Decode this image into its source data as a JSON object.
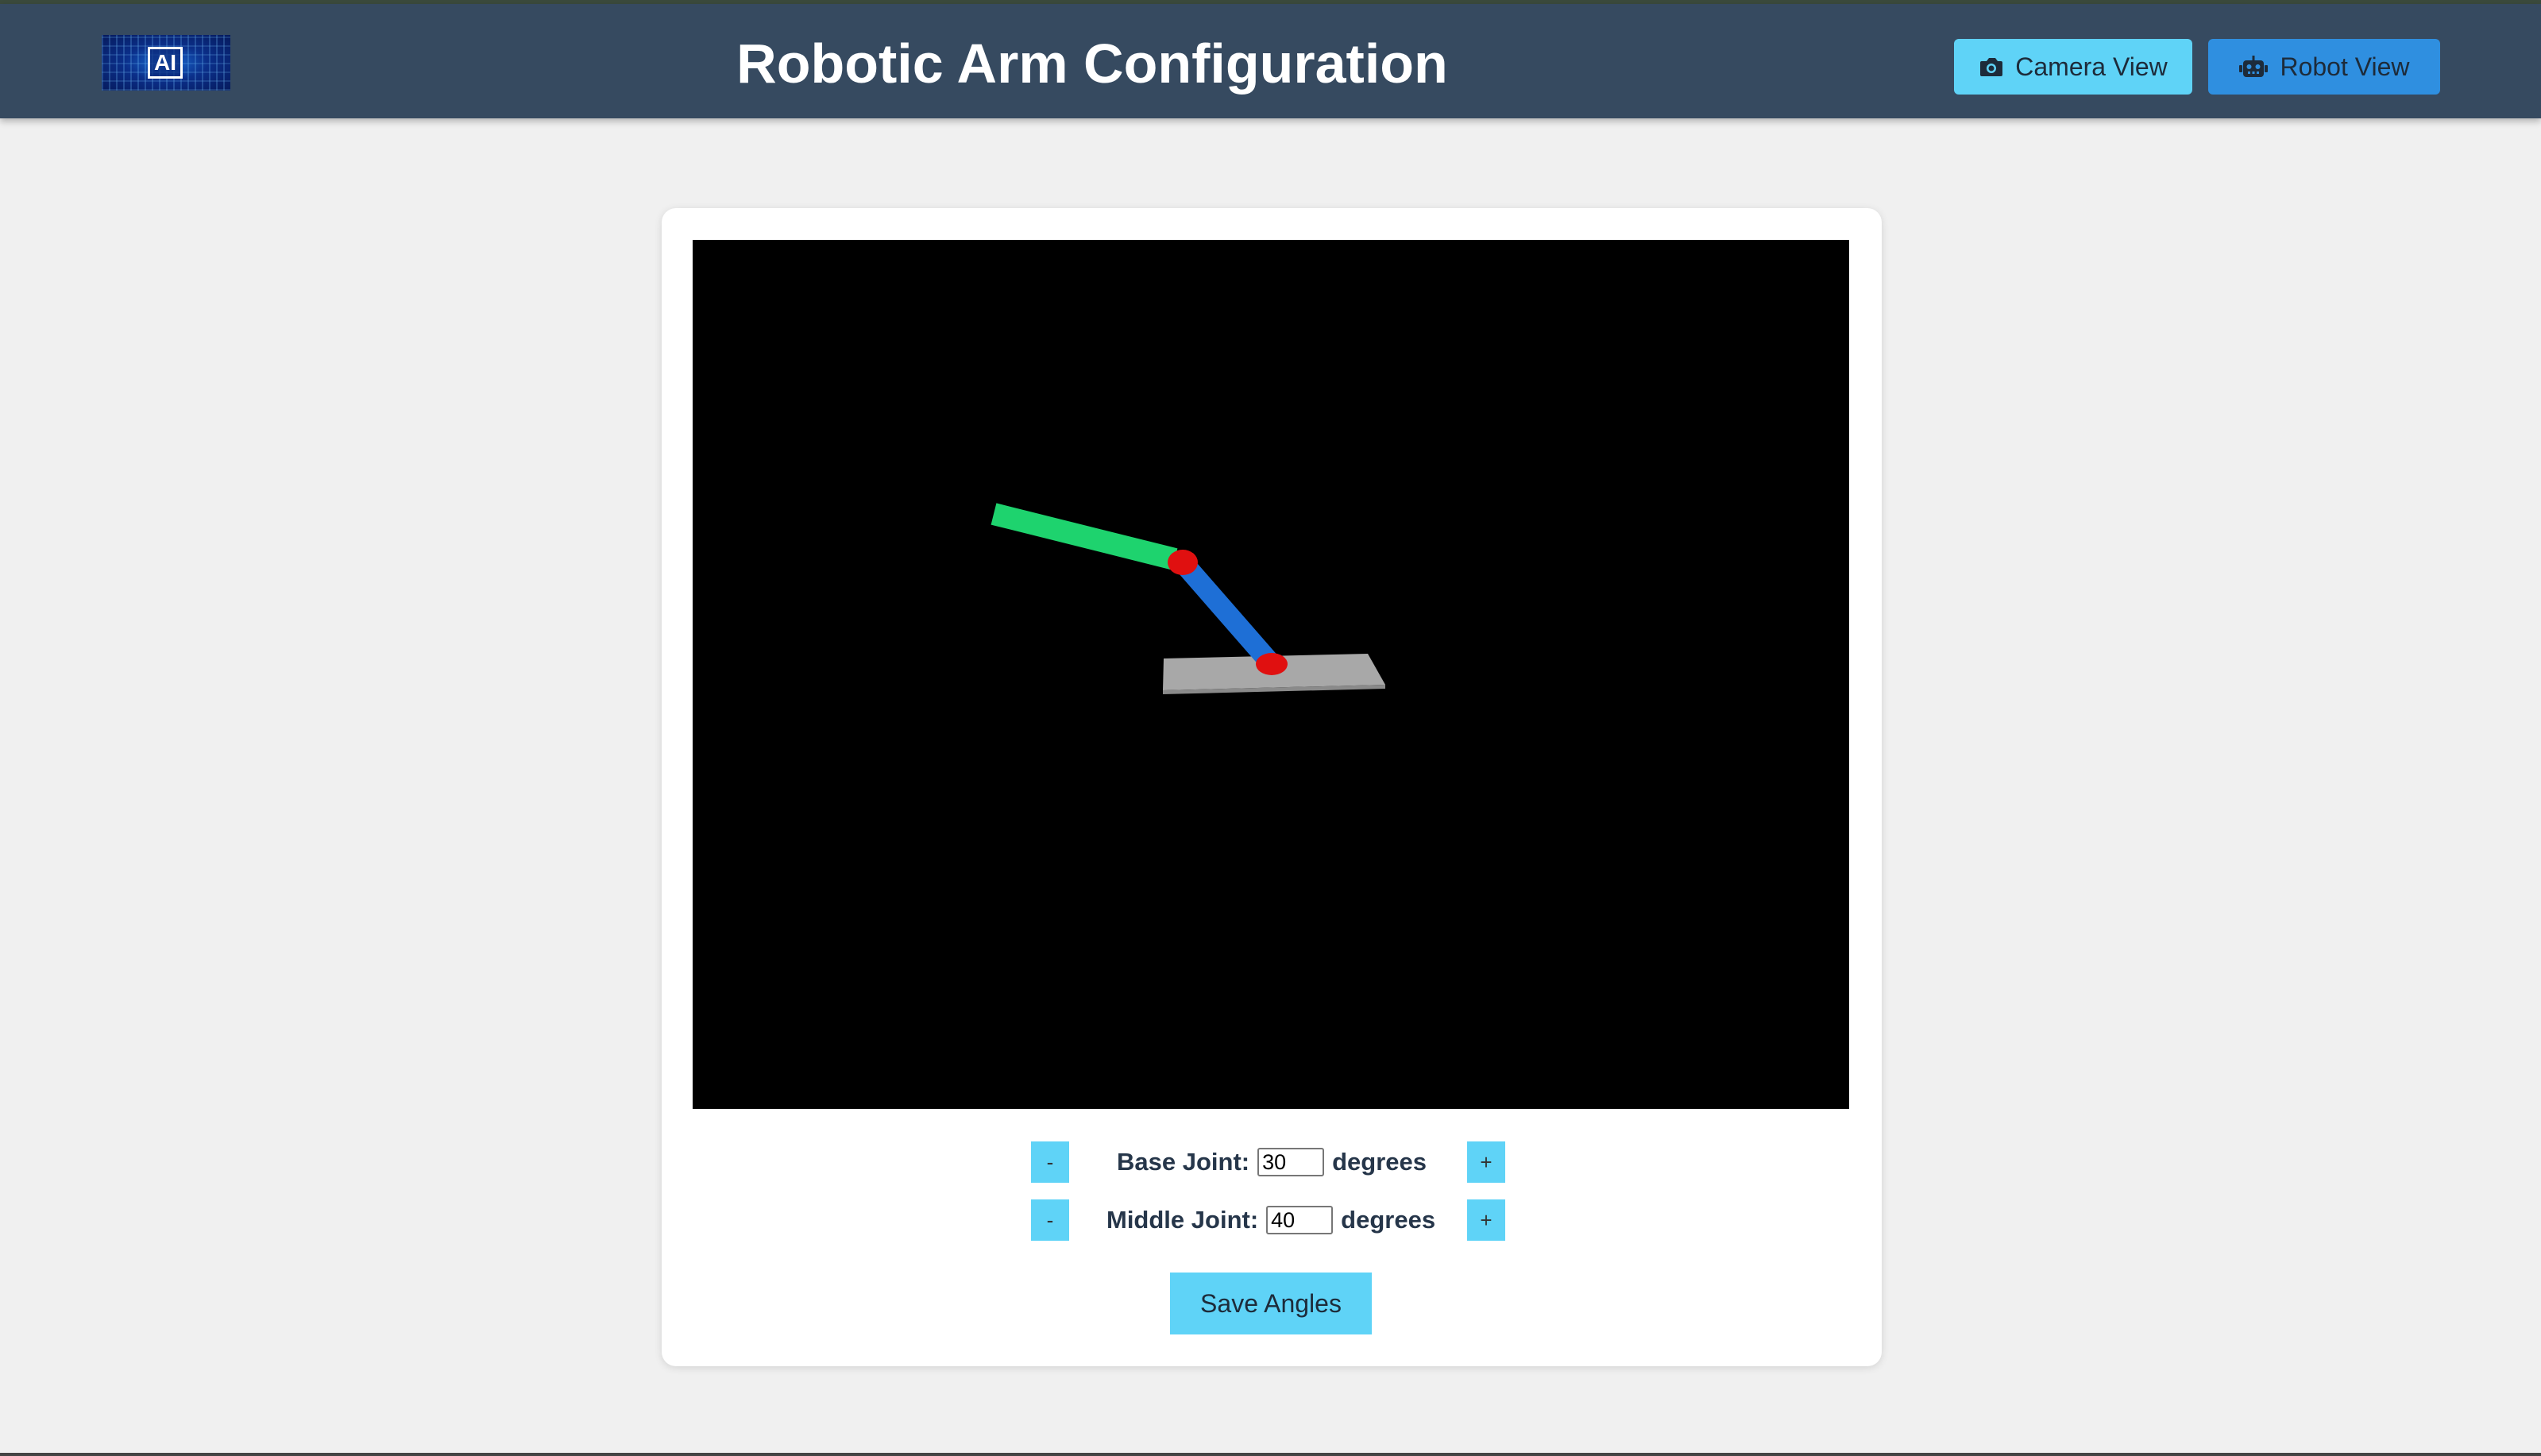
{
  "header": {
    "title": "Robotic Arm Configuration",
    "logo_text": "AI",
    "camera_view_label": "Camera View",
    "robot_view_label": "Robot View",
    "camera_icon": "camera-icon",
    "robot_icon": "robot-icon"
  },
  "controls": {
    "base_joint": {
      "label": "Base Joint:",
      "value": "30",
      "unit": "degrees",
      "minus": "-",
      "plus": "+"
    },
    "middle_joint": {
      "label": "Middle Joint:",
      "value": "40",
      "unit": "degrees",
      "minus": "-",
      "plus": "+"
    },
    "save_label": "Save Angles"
  },
  "colors": {
    "header_bg": "#364a60",
    "camera_button": "#5fd3f7",
    "robot_button": "#2f8fe0",
    "arm_lower": "#1e6fd6",
    "arm_upper": "#1ed36e",
    "joint": "#e01010",
    "base_plate": "#a8a8a8"
  }
}
